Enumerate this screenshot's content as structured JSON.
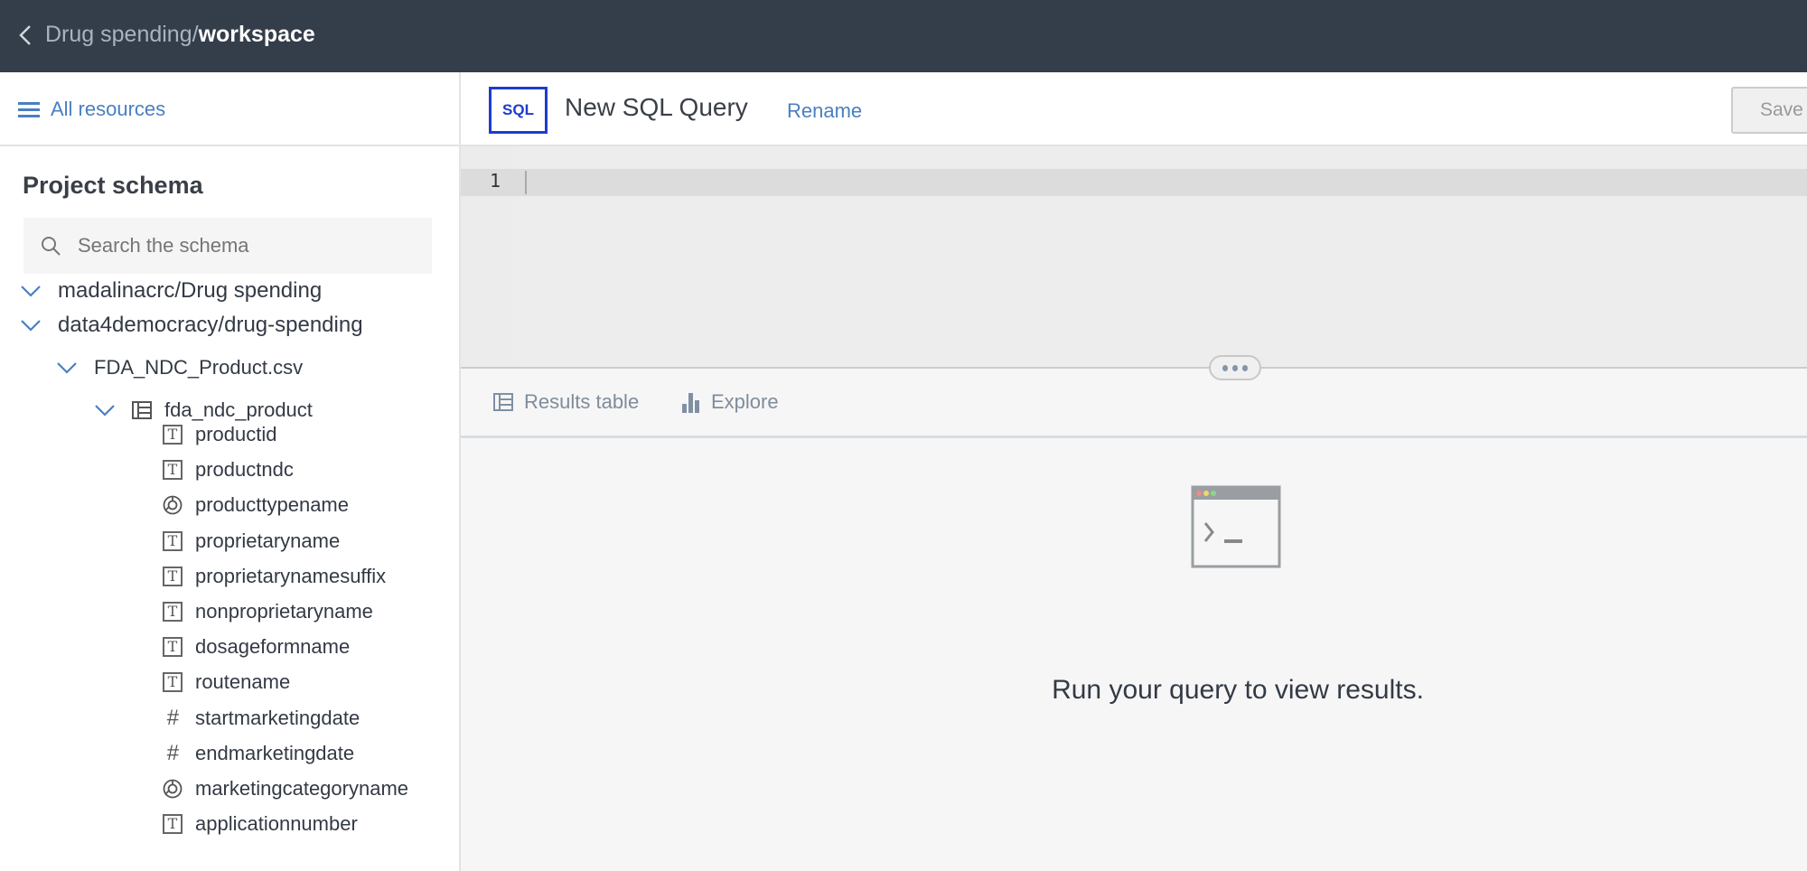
{
  "topbar": {
    "project": "Drug spending",
    "separator": "/",
    "page": "workspace"
  },
  "sidebar": {
    "all_resources": "All resources",
    "title": "Project schema",
    "search_placeholder": "Search the schema",
    "tree": [
      {
        "label": "madalinacrc/Drug spending",
        "level": 0,
        "expanded": true
      },
      {
        "label": "data4democracy/drug-spending",
        "level": 0,
        "expanded": true
      },
      {
        "label": "FDA_NDC_Product.csv",
        "level": 1,
        "expanded": true
      },
      {
        "label": "fda_ndc_product",
        "level": 2,
        "expanded": true,
        "icon": "table-icon"
      }
    ],
    "columns": [
      {
        "name": "productid",
        "type": "text"
      },
      {
        "name": "productndc",
        "type": "text"
      },
      {
        "name": "producttypename",
        "type": "category"
      },
      {
        "name": "proprietaryname",
        "type": "text"
      },
      {
        "name": "proprietarynamesuffix",
        "type": "text"
      },
      {
        "name": "nonproprietaryname",
        "type": "text"
      },
      {
        "name": "dosageformname",
        "type": "text"
      },
      {
        "name": "routename",
        "type": "text"
      },
      {
        "name": "startmarketingdate",
        "type": "number"
      },
      {
        "name": "endmarketingdate",
        "type": "number"
      },
      {
        "name": "marketingcategoryname",
        "type": "category"
      },
      {
        "name": "applicationnumber",
        "type": "text"
      }
    ]
  },
  "query": {
    "badge": "SQL",
    "title": "New SQL Query",
    "rename": "Rename",
    "save": "Save",
    "line_number": "1"
  },
  "tabs": [
    {
      "label": "Results table",
      "icon": "table-icon"
    },
    {
      "label": "Explore",
      "icon": "bar-chart-icon"
    }
  ],
  "results": {
    "message": "Run your query to view results."
  },
  "colors": {
    "topbar": "#343d4a",
    "accent": "#4a7fc1",
    "sql_badge": "#1d3ccc"
  }
}
